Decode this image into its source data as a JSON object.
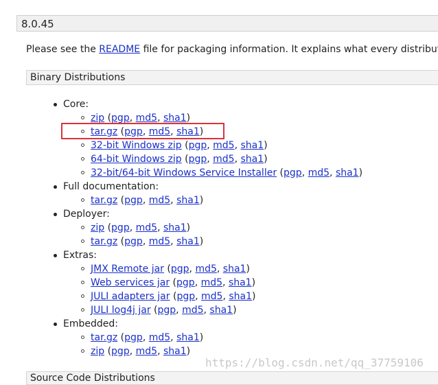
{
  "version": "8.0.45",
  "intro": {
    "prefix": "Please see the ",
    "readme_link": "README",
    "suffix": " file for packaging information. It explains what every distribution"
  },
  "binary_section_title": "Binary Distributions",
  "source_section_title": "Source Code Distributions",
  "core": {
    "label": "Core:",
    "items": [
      {
        "main": "zip",
        "sigs": [
          "pgp",
          "md5",
          "sha1"
        ]
      },
      {
        "main": "tar.gz",
        "sigs": [
          "pgp",
          "md5",
          "sha1"
        ]
      },
      {
        "main": "32-bit Windows zip",
        "sigs": [
          "pgp",
          "md5",
          "sha1"
        ]
      },
      {
        "main": "64-bit Windows zip",
        "sigs": [
          "pgp",
          "md5",
          "sha1"
        ]
      },
      {
        "main": "32-bit/64-bit Windows Service Installer",
        "sigs": [
          "pgp",
          "md5",
          "sha1"
        ]
      }
    ]
  },
  "full_doc": {
    "label": "Full documentation:",
    "items": [
      {
        "main": "tar.gz",
        "sigs": [
          "pgp",
          "md5",
          "sha1"
        ]
      }
    ]
  },
  "deployer": {
    "label": "Deployer:",
    "items": [
      {
        "main": "zip",
        "sigs": [
          "pgp",
          "md5",
          "sha1"
        ]
      },
      {
        "main": "tar.gz",
        "sigs": [
          "pgp",
          "md5",
          "sha1"
        ]
      }
    ]
  },
  "extras": {
    "label": "Extras:",
    "items": [
      {
        "main": "JMX Remote jar",
        "sigs": [
          "pgp",
          "md5",
          "sha1"
        ]
      },
      {
        "main": "Web services jar",
        "sigs": [
          "pgp",
          "md5",
          "sha1"
        ]
      },
      {
        "main": "JULI adapters jar",
        "sigs": [
          "pgp",
          "md5",
          "sha1"
        ]
      },
      {
        "main": "JULI log4j jar",
        "sigs": [
          "pgp",
          "md5",
          "sha1"
        ]
      }
    ]
  },
  "embedded": {
    "label": "Embedded:",
    "items": [
      {
        "main": "tar.gz",
        "sigs": [
          "pgp",
          "md5",
          "sha1"
        ]
      },
      {
        "main": "zip",
        "sigs": [
          "pgp",
          "md5",
          "sha1"
        ]
      }
    ]
  },
  "watermark": "https://blog.csdn.net/qq_37759106",
  "colors": {
    "link": "#1a30c8",
    "highlight": "#d9333b"
  }
}
